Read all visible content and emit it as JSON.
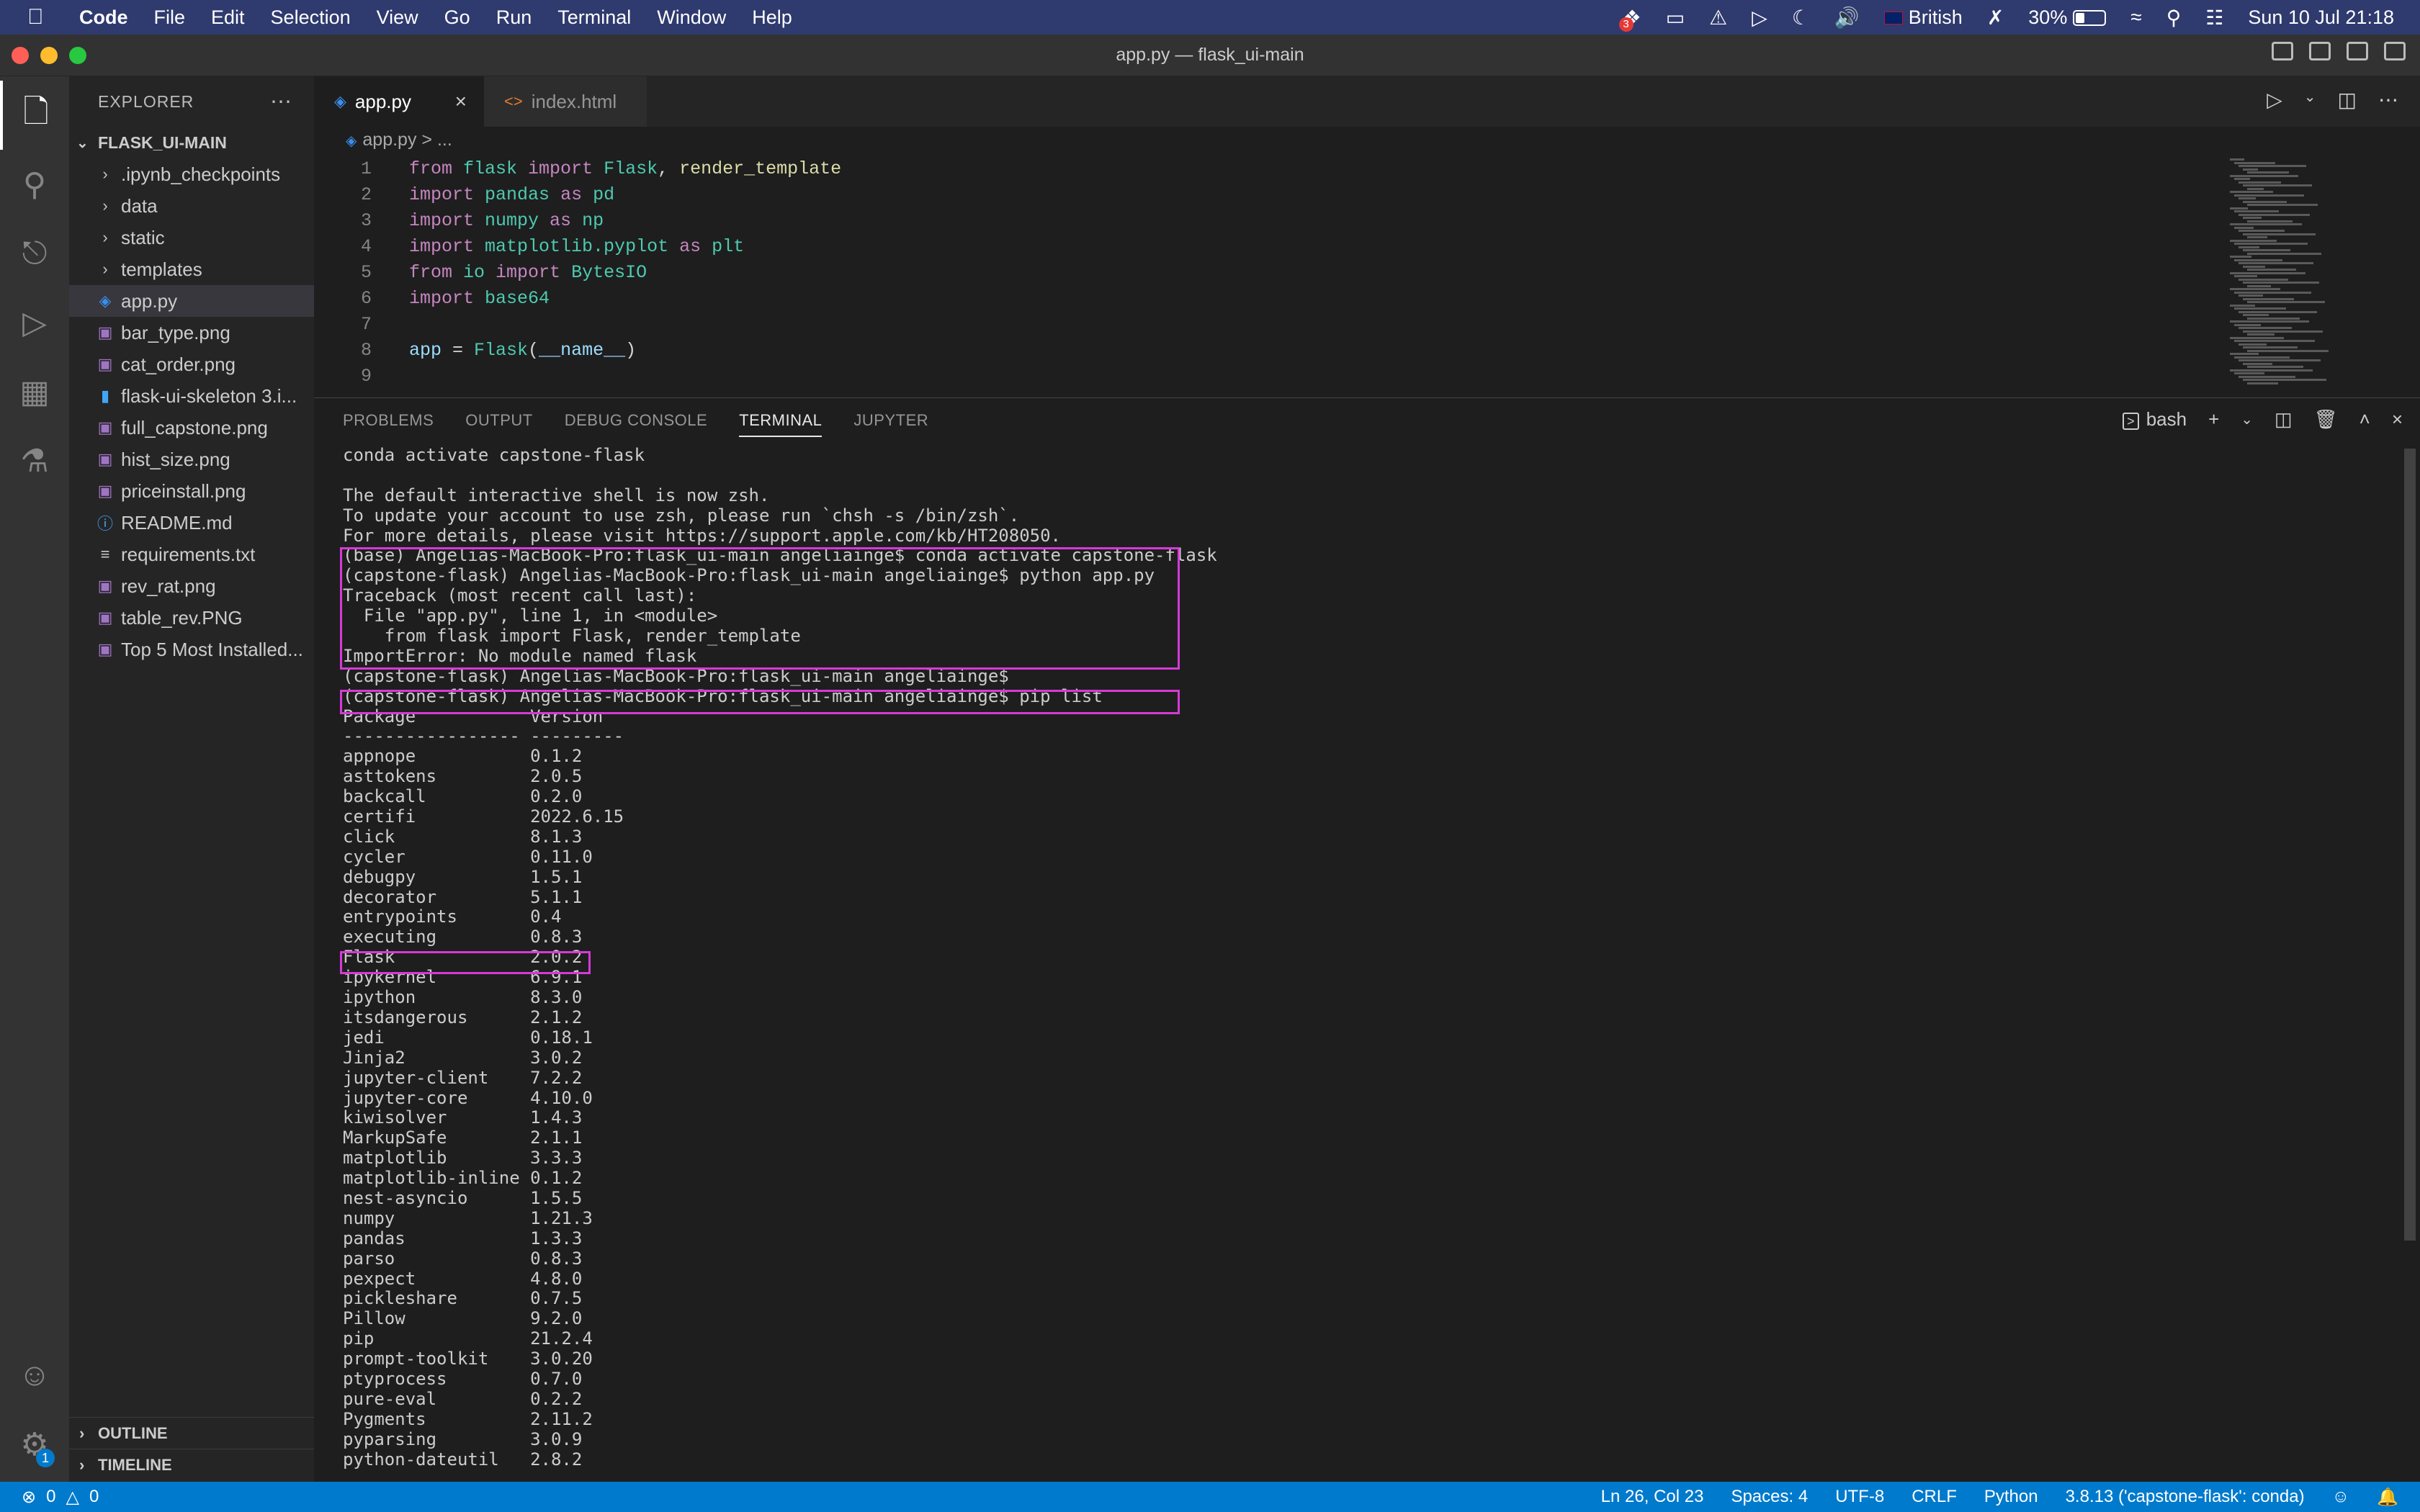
{
  "menubar": {
    "app": "Code",
    "items": [
      "File",
      "Edit",
      "Selection",
      "View",
      "Go",
      "Run",
      "Terminal",
      "Window",
      "Help"
    ],
    "badge_count": "3",
    "language": "British",
    "battery": "30%",
    "datetime": "Sun 10 Jul  21:18"
  },
  "window": {
    "title": "app.py — flask_ui-main"
  },
  "sidebar": {
    "header": "EXPLORER",
    "root": "FLASK_UI-MAIN",
    "items": [
      {
        "label": ".ipynb_checkpoints",
        "type": "folder"
      },
      {
        "label": "data",
        "type": "folder"
      },
      {
        "label": "static",
        "type": "folder"
      },
      {
        "label": "templates",
        "type": "folder"
      },
      {
        "label": "app.py",
        "type": "python"
      },
      {
        "label": "bar_type.png",
        "type": "image"
      },
      {
        "label": "cat_order.png",
        "type": "image"
      },
      {
        "label": "flask-ui-skeleton 3.i...",
        "type": "notebook"
      },
      {
        "label": "full_capstone.png",
        "type": "image"
      },
      {
        "label": "hist_size.png",
        "type": "image"
      },
      {
        "label": "priceinstall.png",
        "type": "image"
      },
      {
        "label": "README.md",
        "type": "info"
      },
      {
        "label": "requirements.txt",
        "type": "text"
      },
      {
        "label": "rev_rat.png",
        "type": "image"
      },
      {
        "label": "table_rev.PNG",
        "type": "image"
      },
      {
        "label": "Top 5 Most Installed...",
        "type": "image"
      }
    ],
    "outline": "OUTLINE",
    "timeline": "TIMELINE",
    "settings_badge": "1"
  },
  "editor": {
    "tabs": [
      {
        "label": "app.py",
        "active": true
      },
      {
        "label": "index.html",
        "active": false
      }
    ],
    "breadcrumb": "app.py  >  ...",
    "lines": [
      {
        "n": "1",
        "tokens": [
          [
            "kw",
            "from "
          ],
          [
            "md",
            "flask "
          ],
          [
            "kw",
            "import "
          ],
          [
            "md",
            "Flask"
          ],
          [
            "pl",
            ", "
          ],
          [
            "fn",
            "render_template"
          ]
        ]
      },
      {
        "n": "2",
        "tokens": [
          [
            "kw",
            "import "
          ],
          [
            "md",
            "pandas "
          ],
          [
            "kw",
            "as "
          ],
          [
            "md",
            "pd"
          ]
        ]
      },
      {
        "n": "3",
        "tokens": [
          [
            "kw",
            "import "
          ],
          [
            "md",
            "numpy "
          ],
          [
            "kw",
            "as "
          ],
          [
            "md",
            "np"
          ]
        ]
      },
      {
        "n": "4",
        "tokens": [
          [
            "kw",
            "import "
          ],
          [
            "md",
            "matplotlib.pyplot "
          ],
          [
            "kw",
            "as "
          ],
          [
            "md",
            "plt"
          ]
        ]
      },
      {
        "n": "5",
        "tokens": [
          [
            "kw",
            "from "
          ],
          [
            "md",
            "io "
          ],
          [
            "kw",
            "import "
          ],
          [
            "md",
            "BytesIO"
          ]
        ]
      },
      {
        "n": "6",
        "tokens": [
          [
            "kw",
            "import "
          ],
          [
            "md",
            "base64"
          ]
        ]
      },
      {
        "n": "7",
        "tokens": []
      },
      {
        "n": "8",
        "tokens": [
          [
            "vr",
            "app "
          ],
          [
            "pl",
            "= "
          ],
          [
            "md",
            "Flask"
          ],
          [
            "pl",
            "("
          ],
          [
            "vr",
            "__name__"
          ],
          [
            "pl",
            ")"
          ]
        ]
      },
      {
        "n": "9",
        "tokens": []
      }
    ]
  },
  "panel": {
    "tabs": [
      "PROBLEMS",
      "OUTPUT",
      "DEBUG CONSOLE",
      "TERMINAL",
      "JUPYTER"
    ],
    "active_tab": "TERMINAL",
    "shell": "bash",
    "terminal_lines": [
      "conda activate capstone-flask",
      "",
      "The default interactive shell is now zsh.",
      "To update your account to use zsh, please run `chsh -s /bin/zsh`.",
      "For more details, please visit https://support.apple.com/kb/HT208050.",
      "(base) Angelias-MacBook-Pro:flask_ui-main angeliainge$ conda activate capstone-flask",
      "(capstone-flask) Angelias-MacBook-Pro:flask_ui-main angeliainge$ python app.py",
      "Traceback (most recent call last):",
      "  File \"app.py\", line 1, in <module>",
      "    from flask import Flask, render_template",
      "ImportError: No module named flask",
      "(capstone-flask) Angelias-MacBook-Pro:flask_ui-main angeliainge$ ",
      "(capstone-flask) Angelias-MacBook-Pro:flask_ui-main angeliainge$ pip list",
      "Package           Version",
      "----------------- ---------",
      "appnope           0.1.2",
      "asttokens         2.0.5",
      "backcall          0.2.0",
      "certifi           2022.6.15",
      "click             8.1.3",
      "cycler            0.11.0",
      "debugpy           1.5.1",
      "decorator         5.1.1",
      "entrypoints       0.4",
      "executing         0.8.3",
      "Flask             2.0.2",
      "ipykernel         6.9.1",
      "ipython           8.3.0",
      "itsdangerous      2.1.2",
      "jedi              0.18.1",
      "Jinja2            3.0.2",
      "jupyter-client    7.2.2",
      "jupyter-core      4.10.0",
      "kiwisolver        1.4.3",
      "MarkupSafe        2.1.1",
      "matplotlib        3.3.3",
      "matplotlib-inline 0.1.2",
      "nest-asyncio      1.5.5",
      "numpy             1.21.3",
      "pandas            1.3.3",
      "parso             0.8.3",
      "pexpect           4.8.0",
      "pickleshare       0.7.5",
      "Pillow            9.2.0",
      "pip               21.2.4",
      "prompt-toolkit    3.0.20",
      "ptyprocess        0.7.0",
      "pure-eval         0.2.2",
      "Pygments          2.11.2",
      "pyparsing         3.0.9",
      "python-dateutil   2.8.2"
    ]
  },
  "statusbar": {
    "errors": "0",
    "warnings": "0",
    "position": "Ln 26, Col 23",
    "spaces": "Spaces: 4",
    "encoding": "UTF-8",
    "eol": "CRLF",
    "language": "Python",
    "interpreter": "3.8.13 ('capstone-flask': conda)"
  },
  "colors": {
    "accent": "#007acc",
    "highlight_box": "#d63ad6",
    "menubar": "#2f3a6e"
  }
}
